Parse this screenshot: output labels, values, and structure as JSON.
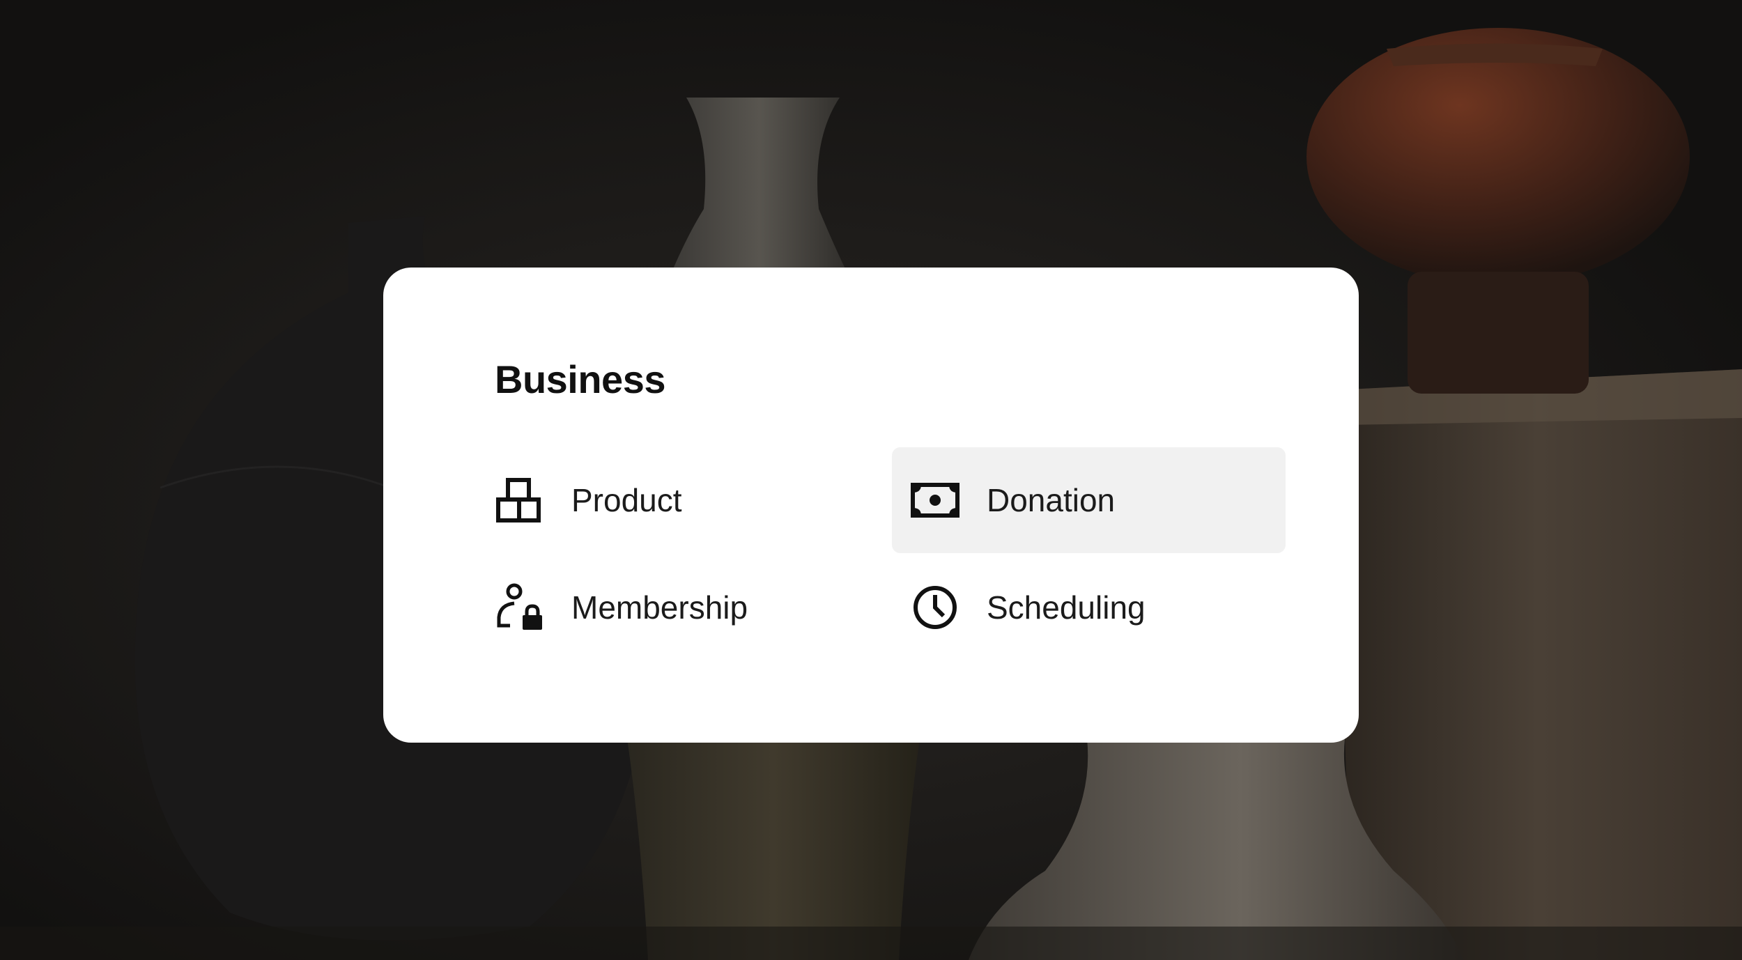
{
  "menu": {
    "title": "Business",
    "items": [
      {
        "label": "Product",
        "icon": "boxes-icon",
        "selected": false
      },
      {
        "label": "Donation",
        "icon": "banknote-icon",
        "selected": true
      },
      {
        "label": "Membership",
        "icon": "person-lock-icon",
        "selected": false
      },
      {
        "label": "Scheduling",
        "icon": "clock-icon",
        "selected": false
      }
    ]
  },
  "colors": {
    "background": "#1d1a17",
    "card": "#ffffff",
    "selected_item": "#f1f1f1",
    "text": "#111111"
  }
}
